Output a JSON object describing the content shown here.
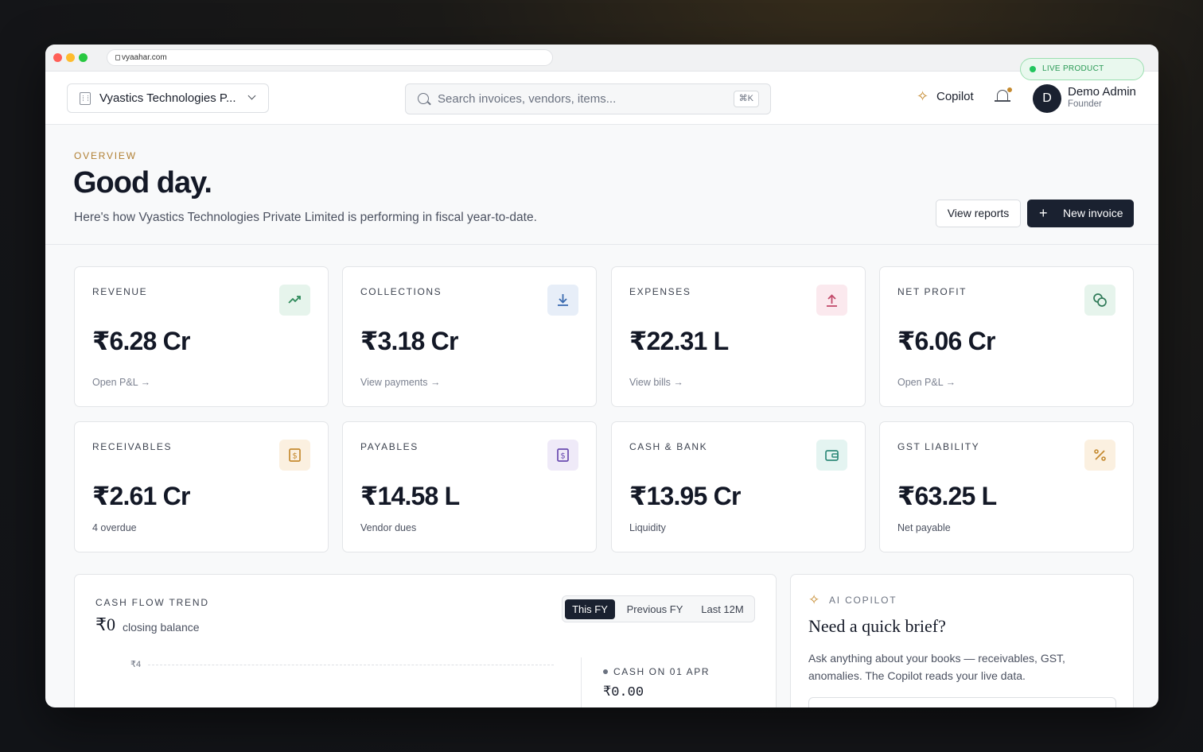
{
  "browser": {
    "url": "vyaahar.com",
    "live_badge": "LIVE PRODUCT"
  },
  "topbar": {
    "org_name": "Vyastics Technologies P...",
    "search_placeholder": "Search invoices, vendors, items...",
    "search_shortcut": "⌘K",
    "copilot_label": "Copilot",
    "user": {
      "initial": "D",
      "name": "Demo Admin",
      "role": "Founder"
    }
  },
  "hero": {
    "eyebrow": "OVERVIEW",
    "greeting": "Good day.",
    "subtitle": "Here's how Vyastics Technologies Private Limited is performing in fiscal year-to-date.",
    "view_reports_label": "View reports",
    "new_invoice_label": "New invoice"
  },
  "kpis": [
    {
      "label": "REVENUE",
      "value": "₹6.28 Cr",
      "foot": "Open P&L →",
      "icon": "trending-up-icon",
      "color": "#2f8a5b"
    },
    {
      "label": "COLLECTIONS",
      "value": "₹3.18 Cr",
      "foot": "View payments →",
      "icon": "download-icon",
      "color": "#3b6bb0"
    },
    {
      "label": "EXPENSES",
      "value": "₹22.31 L",
      "foot": "View bills →",
      "icon": "upload-icon",
      "color": "#c24a6a"
    },
    {
      "label": "NET PROFIT",
      "value": "₹6.06 Cr",
      "foot": "Open P&L →",
      "icon": "coins-icon",
      "color": "#2f7a58"
    },
    {
      "label": "RECEIVABLES",
      "value": "₹2.61 Cr",
      "foot": "4 overdue",
      "icon": "receipt-icon",
      "color": "#c58a2f"
    },
    {
      "label": "PAYABLES",
      "value": "₹14.58 L",
      "foot": "Vendor dues",
      "icon": "receipt-icon",
      "color": "#6a4bb0"
    },
    {
      "label": "CASH & BANK",
      "value": "₹13.95 Cr",
      "foot": "Liquidity",
      "icon": "wallet-icon",
      "color": "#2f8a7a"
    },
    {
      "label": "GST LIABILITY",
      "value": "₹63.25 L",
      "foot": "Net payable",
      "icon": "percent-icon",
      "color": "#c58a2f"
    }
  ],
  "cashflow": {
    "title": "CASH FLOW TREND",
    "balance": "₹0",
    "balance_label": "closing balance",
    "tabs": [
      "This FY",
      "Previous FY",
      "Last 12M"
    ],
    "active_tab": "This FY",
    "y_tick": "₹4",
    "cash_label": "CASH ON 01 APR",
    "cash_value": "₹0.00"
  },
  "copilot": {
    "title": "AI COPILOT",
    "heading": "Need a quick brief?",
    "text": "Ask anything about your books — receivables, GST, anomalies. The Copilot reads your live data."
  }
}
